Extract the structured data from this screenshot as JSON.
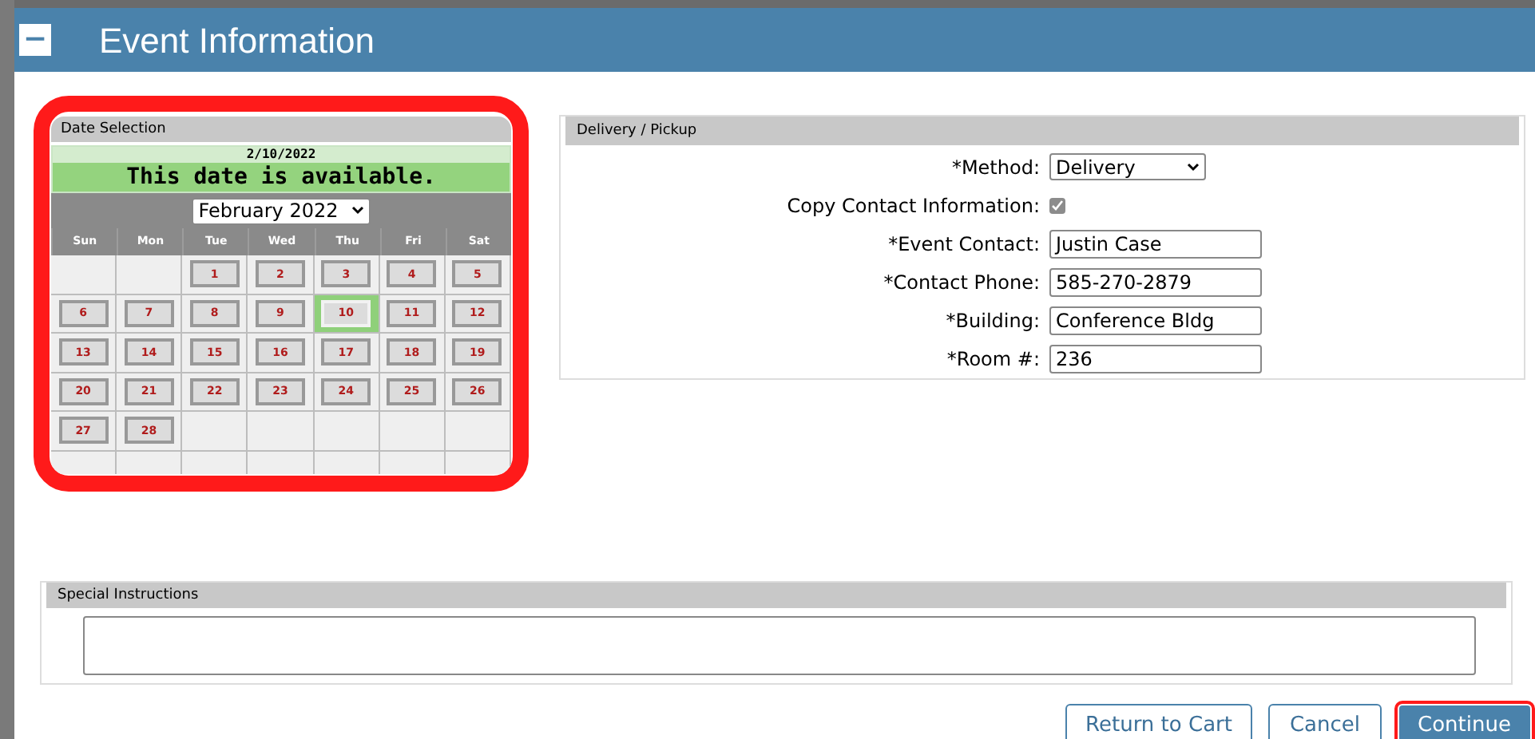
{
  "header": {
    "collapse_icon_char": "−",
    "title": "Event Information"
  },
  "date_selection": {
    "title": "Date Selection",
    "selected_date": "2/10/2022",
    "availability": "This date is available.",
    "available": true,
    "month": "February 2022",
    "weekdays": [
      "Sun",
      "Mon",
      "Tue",
      "Wed",
      "Thu",
      "Fri",
      "Sat"
    ],
    "weeks": [
      [
        {
          "kind": "empty"
        },
        {
          "kind": "empty"
        },
        {
          "kind": "day",
          "day": "1",
          "selected": false
        },
        {
          "kind": "day",
          "day": "2",
          "selected": false
        },
        {
          "kind": "day",
          "day": "3",
          "selected": false
        },
        {
          "kind": "day",
          "day": "4",
          "selected": false
        },
        {
          "kind": "day",
          "day": "5",
          "selected": false
        }
      ],
      [
        {
          "kind": "day",
          "day": "6",
          "selected": false
        },
        {
          "kind": "day",
          "day": "7",
          "selected": false
        },
        {
          "kind": "day",
          "day": "8",
          "selected": false
        },
        {
          "kind": "day",
          "day": "9",
          "selected": false
        },
        {
          "kind": "day",
          "day": "10",
          "selected": true
        },
        {
          "kind": "day",
          "day": "11",
          "selected": false
        },
        {
          "kind": "day",
          "day": "12",
          "selected": false
        }
      ],
      [
        {
          "kind": "day",
          "day": "13",
          "selected": false
        },
        {
          "kind": "day",
          "day": "14",
          "selected": false
        },
        {
          "kind": "day",
          "day": "15",
          "selected": false
        },
        {
          "kind": "day",
          "day": "16",
          "selected": false
        },
        {
          "kind": "day",
          "day": "17",
          "selected": false
        },
        {
          "kind": "day",
          "day": "18",
          "selected": false
        },
        {
          "kind": "day",
          "day": "19",
          "selected": false
        }
      ],
      [
        {
          "kind": "day",
          "day": "20",
          "selected": false
        },
        {
          "kind": "day",
          "day": "21",
          "selected": false
        },
        {
          "kind": "day",
          "day": "22",
          "selected": false
        },
        {
          "kind": "day",
          "day": "23",
          "selected": false
        },
        {
          "kind": "day",
          "day": "24",
          "selected": false
        },
        {
          "kind": "day",
          "day": "25",
          "selected": false
        },
        {
          "kind": "day",
          "day": "26",
          "selected": false
        }
      ],
      [
        {
          "kind": "day",
          "day": "27",
          "selected": false
        },
        {
          "kind": "day",
          "day": "28",
          "selected": false
        },
        {
          "kind": "empty"
        },
        {
          "kind": "empty"
        },
        {
          "kind": "empty"
        },
        {
          "kind": "empty"
        },
        {
          "kind": "empty"
        }
      ],
      [
        {
          "kind": "empty"
        },
        {
          "kind": "empty"
        },
        {
          "kind": "empty"
        },
        {
          "kind": "empty"
        },
        {
          "kind": "empty"
        },
        {
          "kind": "empty"
        },
        {
          "kind": "empty"
        }
      ]
    ]
  },
  "delivery": {
    "title": "Delivery / Pickup",
    "fields": [
      {
        "kind": "select",
        "label": "*Method:",
        "value": "Delivery"
      },
      {
        "kind": "checkbox",
        "label": "Copy Contact Information:",
        "checked": true
      },
      {
        "kind": "text",
        "label": "*Event Contact:",
        "value": "Justin Case"
      },
      {
        "kind": "text",
        "label": "*Contact Phone:",
        "value": "585-270-2879"
      },
      {
        "kind": "text",
        "label": "*Building:",
        "value": "Conference Bldg"
      },
      {
        "kind": "text",
        "label": "*Room #:",
        "value": "236"
      }
    ]
  },
  "special_instructions": {
    "title": "Special Instructions"
  },
  "buttons": [
    {
      "label": "Return to Cart",
      "primary": false
    },
    {
      "label": "Cancel",
      "primary": false
    },
    {
      "label": "Continue",
      "primary": true
    }
  ]
}
